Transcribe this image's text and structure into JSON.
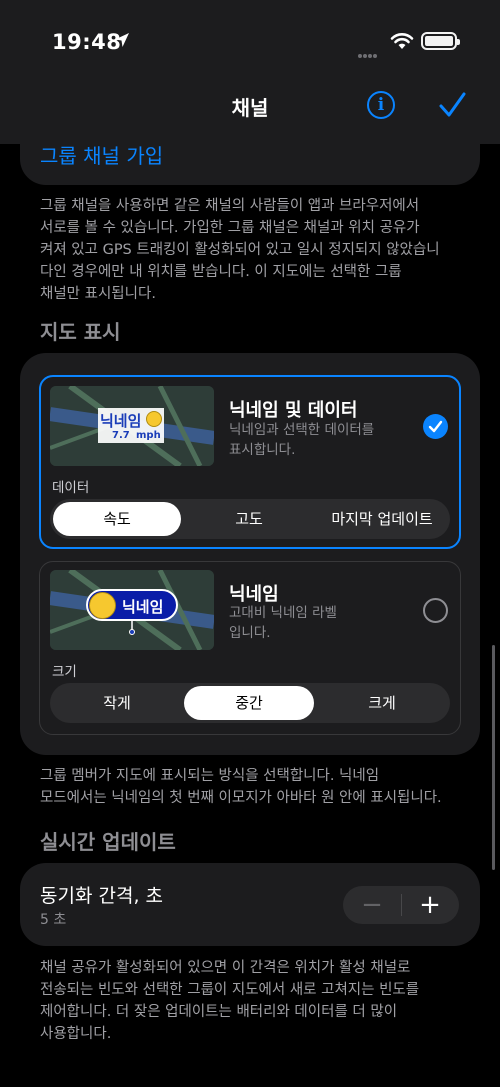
{
  "status_bar": {
    "time": "19:48"
  },
  "nav": {
    "title": "채널",
    "info_icon": "info-circle-icon",
    "done_icon": "checkmark-icon"
  },
  "join": {
    "link_label": "그룹 채널 가입"
  },
  "group_note": [
    "그룹 채널을 사용하면 같은 채널의 사람들이 앱과 브라우저에서",
    "서로를 볼 수 있습니다. 가입한 그룹 채널은 채널과 위치 공유가",
    "켜져 있고 GPS 트래킹이 활성화되어 있고 일시 정지되지 않았습니",
    "다인 경우에만 내 위치를 받습니다. 이 지도에는 선택한 그룹",
    "채널만 표시됩니다."
  ],
  "map_display": {
    "header": "지도 표시",
    "options": [
      {
        "title": "닉네임 및 데이터",
        "description": [
          "닉네임과 선택한 데이터를",
          "표시합니다."
        ],
        "preview_name": "닉네임",
        "preview_value": "7.7",
        "preview_unit": "mph",
        "selected": true,
        "sub_label": "데이터",
        "segments": [
          "속도",
          "고도",
          "마지막 업데이트"
        ],
        "active_segment": "속도"
      },
      {
        "title": "닉네임",
        "description": [
          "고대비 닉네임 라벨",
          "입니다."
        ],
        "preview_name": "닉네임",
        "selected": false,
        "sub_label": "크기",
        "segments": [
          "작게",
          "중간",
          "크게"
        ],
        "active_segment": "중간"
      }
    ],
    "note": [
      "그룹 멤버가 지도에 표시되는 방식을 선택합니다. 닉네임",
      "모드에서는 닉네임의 첫 번째 이모지가 아바타 원 안에 표시됩니다."
    ]
  },
  "realtime": {
    "header": "실시간 업데이트",
    "sync_title": "동기화 간격, 초",
    "sync_value": "5 초",
    "minus": "−",
    "plus": "+",
    "note": [
      "채널 공유가 활성화되어 있으면 이 간격은 위치가 활성 채널로",
      "전송되는 빈도와 선택한 그룹이 지도에서 새로 고쳐지는 빈도를",
      "제어합니다. 더 잦은 업데이트는 배터리와 데이터를 더 많이",
      "사용합니다."
    ]
  },
  "colors": {
    "accent": "#0a84ff",
    "background": "#000000",
    "card": "#1c1c1e"
  }
}
